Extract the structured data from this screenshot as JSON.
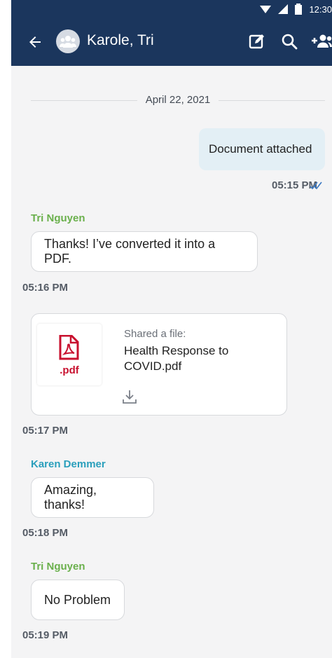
{
  "status_bar": {
    "time": "12:30"
  },
  "header": {
    "title": "Karole, Tri"
  },
  "date_divider": "April 22, 2021",
  "messages": [
    {
      "text": "Document attached",
      "time": "05:15 PM"
    },
    {
      "sender": "Tri Nguyen",
      "text": "Thanks! I’ve converted it into a PDF.",
      "time": "05:16 PM"
    },
    {
      "file_caption": "Shared a file:",
      "file_name": "Health Response to COVID.pdf",
      "file_ext": ".pdf",
      "time": "05:17 PM"
    },
    {
      "sender": "Karen Demmer",
      "text": "Amazing, thanks!",
      "time": "05:18 PM"
    },
    {
      "sender": "Tri Nguyen",
      "text": "No Problem",
      "time": "05:19 PM"
    }
  ],
  "colors": {
    "header_bg": "#1b365d",
    "sender_tri": "#6ab04c",
    "sender_karen": "#2a9fbc",
    "read_ticks": "#3a78c2",
    "pdf_red": "#c8102e"
  }
}
